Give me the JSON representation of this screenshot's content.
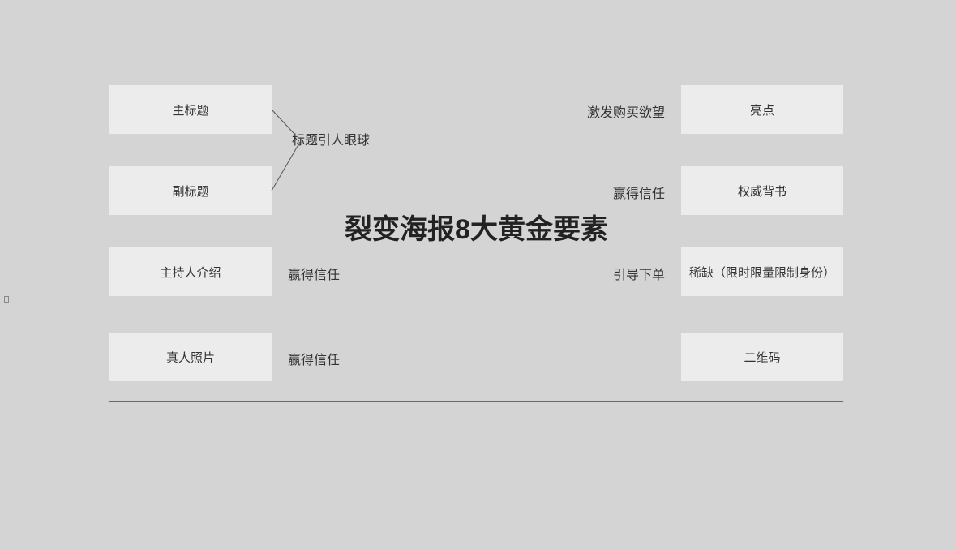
{
  "center_title": "裂变海报8大黄金要素",
  "left": {
    "row1": {
      "box": "主标题"
    },
    "row2": {
      "box": "副标题"
    },
    "row3": {
      "box": "主持人介绍",
      "label": "赢得信任"
    },
    "row4": {
      "box": "真人照片",
      "label": "赢得信任"
    },
    "shared_label_12": "标题引人眼球"
  },
  "right": {
    "row1": {
      "box": "亮点",
      "label": "激发购买欲望"
    },
    "row2": {
      "box": "权威背书",
      "label": "赢得信任"
    },
    "row3": {
      "box": "稀缺（限时限量限制身份）",
      "label": "引导下单"
    },
    "row4": {
      "box": "二维码"
    }
  }
}
